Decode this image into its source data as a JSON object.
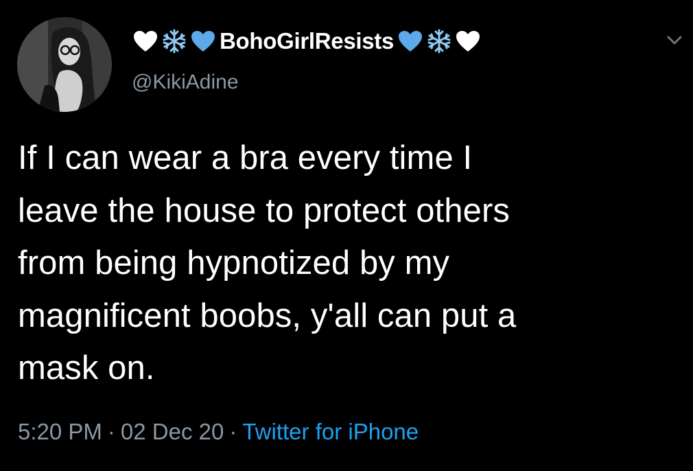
{
  "user": {
    "display_name": "BohoGirlResists",
    "handle": "@KikiAdine",
    "name_emojis_before": [
      "white-heart",
      "snowflake",
      "blue-heart"
    ],
    "name_emojis_after": [
      "blue-heart",
      "snowflake",
      "white-heart"
    ]
  },
  "tweet": {
    "text": "If I can wear a bra every time I\nleave the house to protect others\nfrom being hypnotized by my\nmagnificent boobs, y'all can put a\nmask on.",
    "time": "5:20 PM",
    "date": "02 Dec 20",
    "separator": "·",
    "source": "Twitter for iPhone"
  },
  "colors": {
    "background": "#000000",
    "text": "#ffffff",
    "muted": "#8b98a5",
    "link": "#1da1f2",
    "blue_heart": "#5da9e9",
    "snowflake": "#8ecbf5"
  }
}
